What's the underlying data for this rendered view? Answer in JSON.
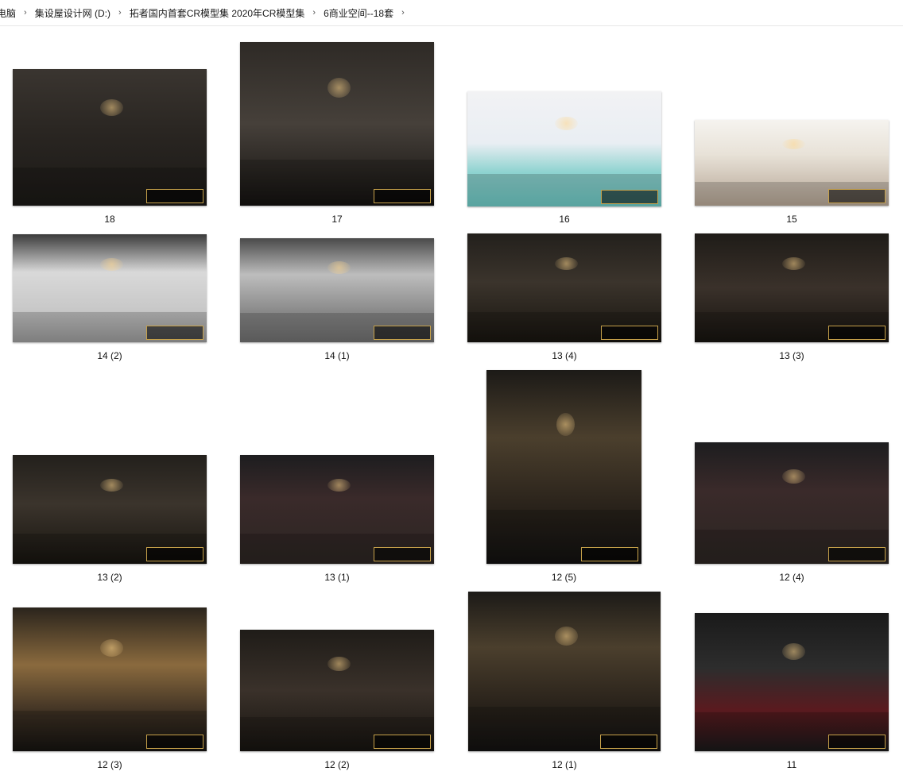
{
  "breadcrumb": [
    "电脑",
    "集设屋设计网 (D:)",
    "拓者国内首套CR模型集 2020年CR模型集",
    "6商业空间--18套"
  ],
  "files": [
    {
      "label": "18",
      "theme": "dark1"
    },
    {
      "label": "17",
      "theme": "dark2"
    },
    {
      "label": "16",
      "theme": "kid"
    },
    {
      "label": "15",
      "theme": "learn"
    },
    {
      "label": "14 (2)",
      "theme": "gal1"
    },
    {
      "label": "14 (1)",
      "theme": "gal2"
    },
    {
      "label": "13 (4)",
      "theme": "bar"
    },
    {
      "label": "13 (3)",
      "theme": "bar2"
    },
    {
      "label": "13 (2)",
      "theme": "bar"
    },
    {
      "label": "13 (1)",
      "theme": "red"
    },
    {
      "label": "12 (5)",
      "theme": "gold"
    },
    {
      "label": "12 (4)",
      "theme": "red"
    },
    {
      "label": "12 (3)",
      "theme": "wine"
    },
    {
      "label": "12 (2)",
      "theme": "bar2"
    },
    {
      "label": "12 (1)",
      "theme": "gold"
    },
    {
      "label": "11",
      "theme": "lux"
    }
  ]
}
